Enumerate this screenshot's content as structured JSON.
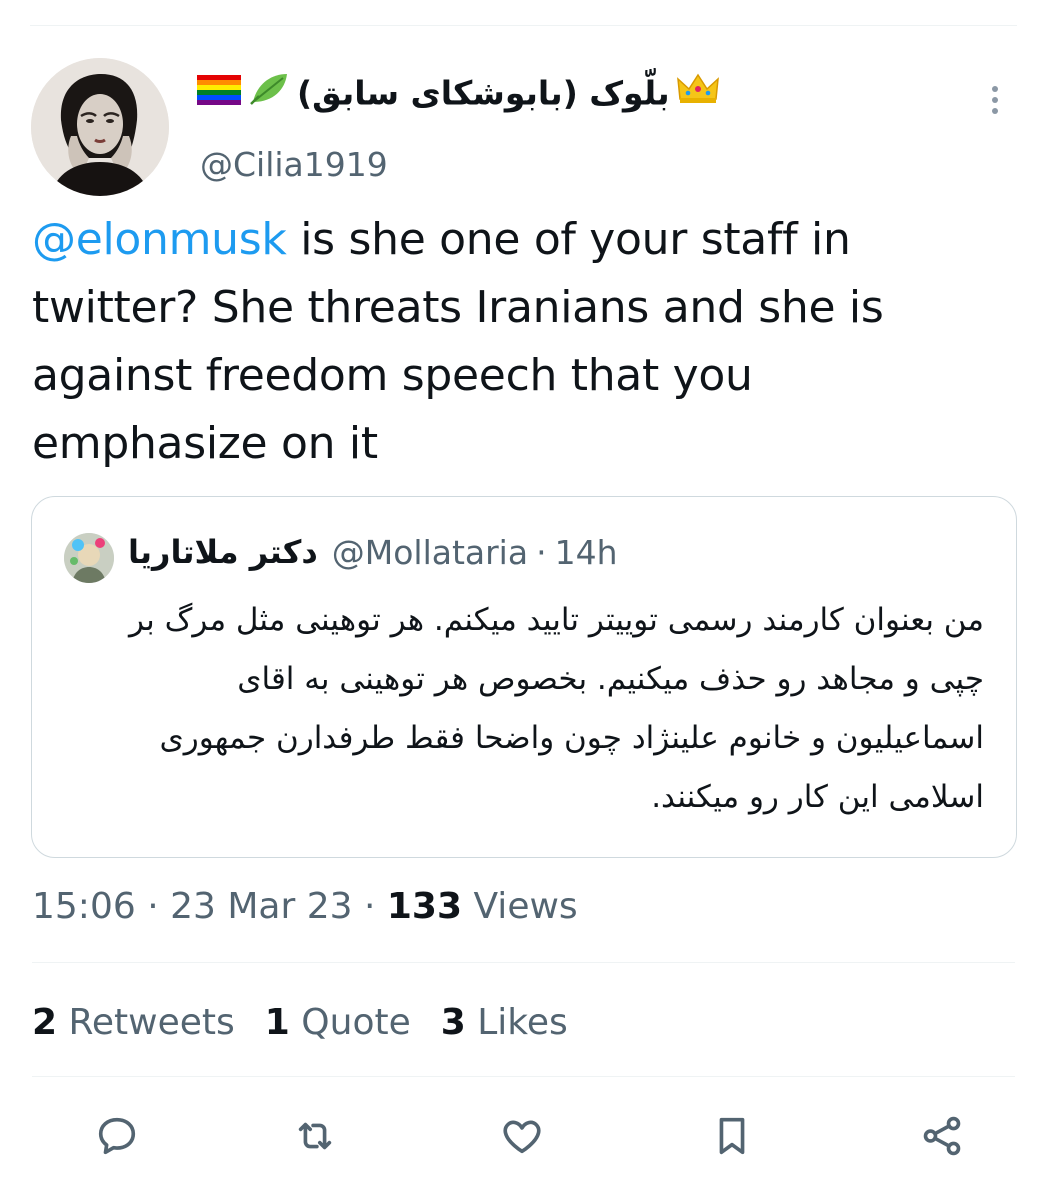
{
  "author": {
    "display_name": "بلّوک (بابوشکای سابق)",
    "handle": "@Cilia1919",
    "emoji": [
      "rainbow-flag",
      "leaf",
      "crown"
    ]
  },
  "tweet": {
    "mention": "@elonmusk",
    "text": " is she one of your staff in twitter? She threats Iranians and she is against freedom speech that you emphasize on it"
  },
  "quoted": {
    "name": "دکتر ملاتاریا",
    "handle": "@Mollataria",
    "separator": "·",
    "time": "14h",
    "text": "من بعنوان کارمند رسمی توییتر تایید میکنم. هر توهینی مثل مرگ بر چپی و مجاهد رو حذف میکنیم. بخصوص هر توهینی به اقای اسماعیلیون و خانوم علینژاد چون واضحا فقط طرفدارن جمهوری اسلامی این کار رو میکنند."
  },
  "meta": {
    "time": "15:06",
    "sep1": " · ",
    "date": "23 Mar 23",
    "sep2": " · ",
    "views_count": "133",
    "views_label": " Views"
  },
  "stats": [
    {
      "count": "2",
      "label": " Retweets"
    },
    {
      "count": "1",
      "label": " Quote"
    },
    {
      "count": "3",
      "label": " Likes"
    }
  ],
  "actions": [
    "reply-icon",
    "retweet-icon",
    "like-icon",
    "bookmark-icon",
    "share-icon"
  ],
  "colors": {
    "link": "#1d9bf0",
    "secondary_text": "#536471",
    "primary_text": "#0f1419",
    "border": "#cfd9de",
    "icon": "#536471"
  }
}
